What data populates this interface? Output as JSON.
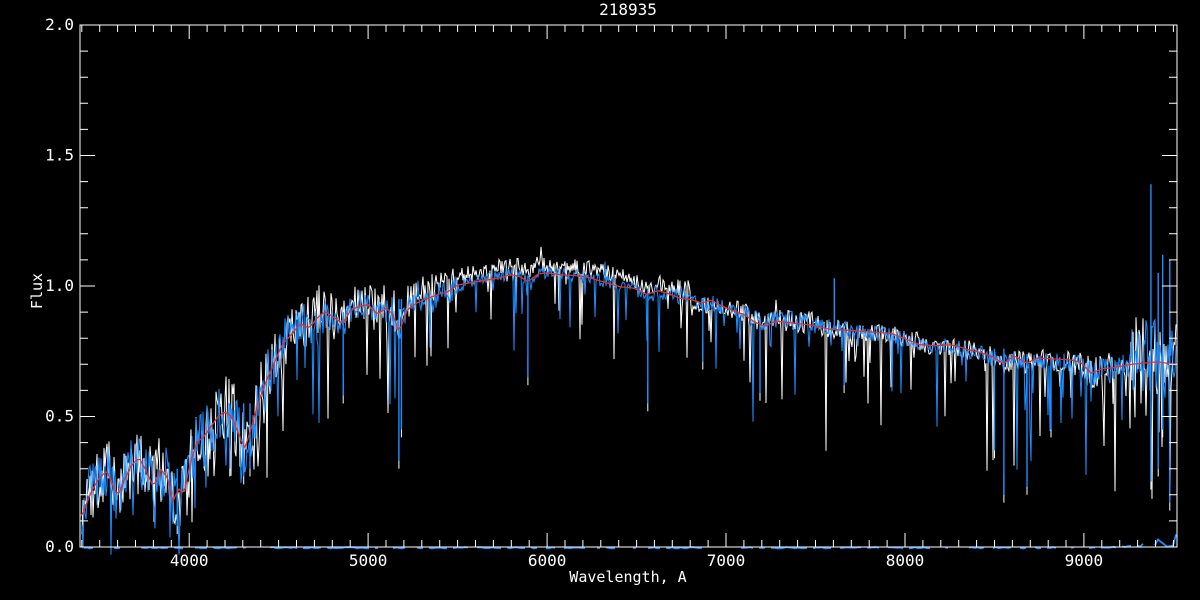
{
  "figure": {
    "background_color": "#000000",
    "axis_color": "#FFFFFF"
  },
  "chart_data": {
    "type": "line",
    "title": "218935",
    "xlabel": "Wavelength, A",
    "ylabel": "Flux",
    "xlim": [
      3390,
      9520
    ],
    "ylim": [
      0.0,
      2.0
    ],
    "grid": false,
    "x_major_ticks": [
      4000,
      5000,
      6000,
      7000,
      8000,
      9000
    ],
    "x_tick_labels": [
      "4000",
      "5000",
      "6000",
      "7000",
      "8000",
      "9000"
    ],
    "x_minor_step": 100,
    "y_major_ticks": [
      0.0,
      0.5,
      1.0,
      1.5,
      2.0
    ],
    "y_tick_labels": [
      "0.0",
      "0.5",
      "1.0",
      "1.5",
      "2.0"
    ],
    "y_minor_step": 0.1,
    "series": [
      {
        "name": "observed-spectrum-1",
        "color": "#FFFFFF",
        "style": "noisy-line"
      },
      {
        "name": "observed-spectrum-2",
        "color": "#1E8FFF",
        "style": "noisy-line"
      },
      {
        "name": "model-fit",
        "color": "#E43030",
        "style": "smooth-line"
      },
      {
        "name": "error-spectrum",
        "color": "#1E8FFF",
        "style": "dashed-baseline"
      }
    ],
    "continuum": {
      "wavelength": [
        3400,
        3450,
        3500,
        3540,
        3560,
        3600,
        3640,
        3680,
        3720,
        3760,
        3800,
        3840,
        3880,
        3910,
        3940,
        3970,
        4000,
        4040,
        4080,
        4120,
        4160,
        4200,
        4240,
        4280,
        4310,
        4340,
        4380,
        4420,
        4470,
        4520,
        4570,
        4620,
        4670,
        4720,
        4760,
        4800,
        4860,
        4900,
        4950,
        5000,
        5050,
        5100,
        5140,
        5172,
        5220,
        5270,
        5320,
        5380,
        5440,
        5500,
        5560,
        5620,
        5680,
        5740,
        5800,
        5850,
        5893,
        5950,
        6000,
        6060,
        6120,
        6180,
        6240,
        6300,
        6360,
        6420,
        6480,
        6520,
        6563,
        6620,
        6680,
        6740,
        6800,
        6860,
        6920,
        6980,
        7040,
        7100,
        7160,
        7220,
        7280,
        7340,
        7400,
        7460,
        7520,
        7580,
        7640,
        7700,
        7760,
        7820,
        7880,
        7940,
        8000,
        8060,
        8120,
        8180,
        8240,
        8300,
        8360,
        8420,
        8480,
        8550,
        8610,
        8680,
        8740,
        8800,
        8860,
        8920,
        8980,
        9040,
        9100,
        9160,
        9220,
        9280,
        9340,
        9400,
        9460,
        9520
      ],
      "flux": [
        0.13,
        0.22,
        0.28,
        0.3,
        0.27,
        0.2,
        0.26,
        0.31,
        0.33,
        0.28,
        0.22,
        0.29,
        0.26,
        0.17,
        0.22,
        0.2,
        0.3,
        0.4,
        0.42,
        0.46,
        0.5,
        0.52,
        0.5,
        0.43,
        0.38,
        0.44,
        0.54,
        0.62,
        0.7,
        0.78,
        0.82,
        0.86,
        0.84,
        0.88,
        0.9,
        0.88,
        0.85,
        0.9,
        0.92,
        0.93,
        0.9,
        0.92,
        0.9,
        0.83,
        0.92,
        0.94,
        0.95,
        0.96,
        0.97,
        1.0,
        1.01,
        1.02,
        1.03,
        1.04,
        1.05,
        1.04,
        1.02,
        1.05,
        1.055,
        1.05,
        1.045,
        1.04,
        1.03,
        1.02,
        1.01,
        1.0,
        0.99,
        0.975,
        0.955,
        0.975,
        0.97,
        0.96,
        0.95,
        0.93,
        0.935,
        0.92,
        0.91,
        0.9,
        0.87,
        0.855,
        0.875,
        0.87,
        0.865,
        0.86,
        0.85,
        0.84,
        0.835,
        0.83,
        0.825,
        0.82,
        0.815,
        0.81,
        0.8,
        0.79,
        0.78,
        0.77,
        0.765,
        0.76,
        0.75,
        0.745,
        0.73,
        0.7,
        0.73,
        0.7,
        0.72,
        0.715,
        0.71,
        0.705,
        0.7,
        0.66,
        0.68,
        0.68,
        0.685,
        0.69,
        0.695,
        0.7,
        0.7,
        0.7
      ]
    },
    "features": [
      {
        "wl": 3933,
        "flux_lo": 0.08,
        "flux_hi": 0.3
      },
      {
        "wl": 4227,
        "flux_lo": 0.3,
        "flux_hi": 0.55
      },
      {
        "wl": 4305,
        "flux_lo": 0.27,
        "flux_hi": 0.55
      },
      {
        "wl": 4340,
        "flux_lo": 0.3,
        "flux_hi": 0.55
      },
      {
        "wl": 4861,
        "flux_lo": 0.58,
        "flux_hi": 0.9
      },
      {
        "wl": 5172,
        "flux_lo": 0.33,
        "flux_hi": 0.95
      },
      {
        "wl": 5186,
        "flux_lo": 0.45,
        "flux_hi": 0.95
      },
      {
        "wl": 5893,
        "flux_lo": 0.65,
        "flux_hi": 1.04
      },
      {
        "wl": 6563,
        "flux_lo": 0.55,
        "flux_hi": 0.99
      },
      {
        "wl": 6870,
        "flux_lo": 0.71,
        "flux_hi": 0.94
      },
      {
        "wl": 7190,
        "flux_lo": 0.59,
        "flux_hi": 0.87
      },
      {
        "wl": 7605,
        "flux_lo": 0.85,
        "flux_hi": 1.03
      },
      {
        "wl": 7660,
        "flux_lo": 0.62,
        "flux_hi": 0.84
      },
      {
        "wl": 8500,
        "flux_lo": 0.37,
        "flux_hi": 0.76
      },
      {
        "wl": 8553,
        "flux_lo": 0.2,
        "flux_hi": 0.76
      },
      {
        "wl": 8682,
        "flux_lo": 0.23,
        "flux_hi": 0.74
      },
      {
        "wl": 8816,
        "flux_lo": 0.45,
        "flux_hi": 0.72
      },
      {
        "wl": 9374,
        "flux_lo": 0.25,
        "flux_hi": 1.39
      },
      {
        "wl": 9415,
        "flux_lo": 0.3,
        "flux_hi": 1.05
      },
      {
        "wl": 9440,
        "flux_lo": 0.45,
        "flux_hi": 1.12
      },
      {
        "wl": 9480,
        "flux_lo": 0.17,
        "flux_hi": 1.1
      }
    ],
    "noise_bands": [
      [
        3390,
        3700,
        0.105
      ],
      [
        3700,
        4450,
        0.115
      ],
      [
        4450,
        4750,
        0.085
      ],
      [
        4750,
        5150,
        0.06
      ],
      [
        5150,
        5500,
        0.05
      ],
      [
        5500,
        6600,
        0.025
      ],
      [
        6600,
        7100,
        0.03
      ],
      [
        7100,
        7700,
        0.035
      ],
      [
        7700,
        8400,
        0.03
      ],
      [
        8400,
        9000,
        0.035
      ],
      [
        9000,
        9260,
        0.05
      ],
      [
        9260,
        9520,
        0.16
      ]
    ],
    "spike_bands": [
      [
        3390,
        4500,
        0.3
      ],
      [
        4500,
        5500,
        0.42
      ],
      [
        5500,
        6800,
        0.32
      ],
      [
        6800,
        7700,
        0.4
      ],
      [
        7700,
        8400,
        0.3
      ],
      [
        8400,
        9100,
        0.45
      ],
      [
        9100,
        9520,
        0.55
      ]
    ],
    "white_offset_bands": [
      [
        4600,
        5300,
        0.02
      ],
      [
        5300,
        6800,
        0.035
      ]
    ],
    "blue_offset_ramp": {
      "from": 9150,
      "per_angstrom": 0.00016
    },
    "error_level": 0.005,
    "error_red_end_bump": 0.04
  }
}
